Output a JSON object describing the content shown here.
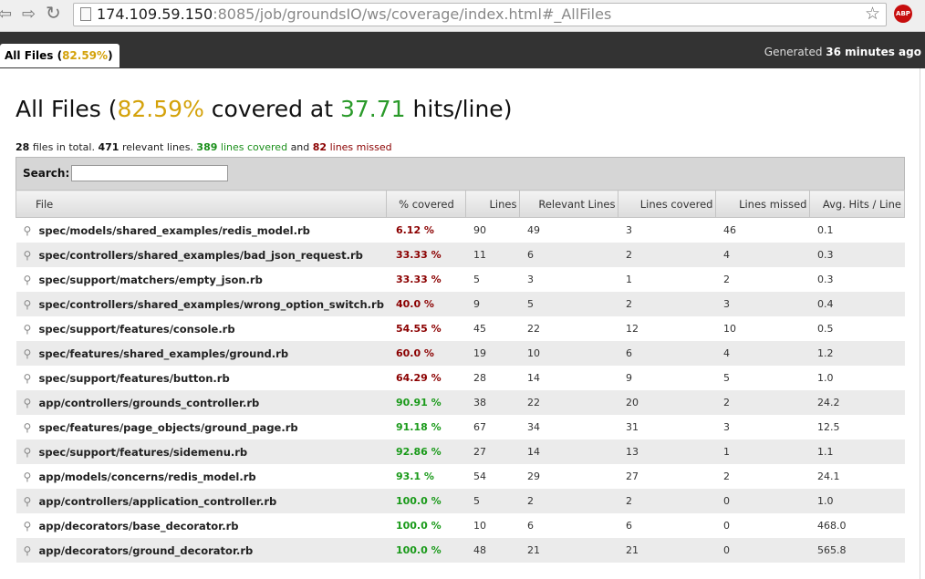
{
  "browser": {
    "url_host": "174.109.59.150",
    "url_path": ":8085/job/groundsIO/ws/coverage/index.html#_AllFiles",
    "adblock_label": "ABP"
  },
  "header": {
    "tab_label": "All Files",
    "tab_percent": "82.59%",
    "generated_prefix": "Generated",
    "generated_time": "36 minutes ago"
  },
  "summary": {
    "title_prefix": "All Files (",
    "coverage": "82.59%",
    "middle": "covered at",
    "hits": "37.71",
    "suffix": "hits/line)",
    "files_count": "28",
    "files_text": "files in total.",
    "relevant_count": "471",
    "relevant_text": "relevant lines.",
    "covered_count": "389",
    "covered_text": "lines covered",
    "and_text": "and",
    "missed_count": "82",
    "missed_text": "lines missed"
  },
  "search": {
    "label": "Search:",
    "value": ""
  },
  "table": {
    "columns": [
      "File",
      "% covered",
      "Lines",
      "Relevant Lines",
      "Lines covered",
      "Lines missed",
      "Avg. Hits / Line"
    ],
    "rows": [
      {
        "file": "spec/models/shared_examples/redis_model.rb",
        "pct": "6.12 %",
        "status": "red",
        "lines": "90",
        "relevant": "49",
        "covered": "3",
        "missed": "46",
        "avg": "0.1"
      },
      {
        "file": "spec/controllers/shared_examples/bad_json_request.rb",
        "pct": "33.33 %",
        "status": "red",
        "lines": "11",
        "relevant": "6",
        "covered": "2",
        "missed": "4",
        "avg": "0.3"
      },
      {
        "file": "spec/support/matchers/empty_json.rb",
        "pct": "33.33 %",
        "status": "red",
        "lines": "5",
        "relevant": "3",
        "covered": "1",
        "missed": "2",
        "avg": "0.3"
      },
      {
        "file": "spec/controllers/shared_examples/wrong_option_switch.rb",
        "pct": "40.0 %",
        "status": "red",
        "lines": "9",
        "relevant": "5",
        "covered": "2",
        "missed": "3",
        "avg": "0.4"
      },
      {
        "file": "spec/support/features/console.rb",
        "pct": "54.55 %",
        "status": "red",
        "lines": "45",
        "relevant": "22",
        "covered": "12",
        "missed": "10",
        "avg": "0.5"
      },
      {
        "file": "spec/features/shared_examples/ground.rb",
        "pct": "60.0 %",
        "status": "red",
        "lines": "19",
        "relevant": "10",
        "covered": "6",
        "missed": "4",
        "avg": "1.2"
      },
      {
        "file": "spec/support/features/button.rb",
        "pct": "64.29 %",
        "status": "red",
        "lines": "28",
        "relevant": "14",
        "covered": "9",
        "missed": "5",
        "avg": "1.0"
      },
      {
        "file": "app/controllers/grounds_controller.rb",
        "pct": "90.91 %",
        "status": "green",
        "lines": "38",
        "relevant": "22",
        "covered": "20",
        "missed": "2",
        "avg": "24.2"
      },
      {
        "file": "spec/features/page_objects/ground_page.rb",
        "pct": "91.18 %",
        "status": "green",
        "lines": "67",
        "relevant": "34",
        "covered": "31",
        "missed": "3",
        "avg": "12.5"
      },
      {
        "file": "spec/support/features/sidemenu.rb",
        "pct": "92.86 %",
        "status": "green",
        "lines": "27",
        "relevant": "14",
        "covered": "13",
        "missed": "1",
        "avg": "1.1"
      },
      {
        "file": "app/models/concerns/redis_model.rb",
        "pct": "93.1 %",
        "status": "green",
        "lines": "54",
        "relevant": "29",
        "covered": "27",
        "missed": "2",
        "avg": "24.1"
      },
      {
        "file": "app/controllers/application_controller.rb",
        "pct": "100.0 %",
        "status": "green",
        "lines": "5",
        "relevant": "2",
        "covered": "2",
        "missed": "0",
        "avg": "1.0"
      },
      {
        "file": "app/decorators/base_decorator.rb",
        "pct": "100.0 %",
        "status": "green",
        "lines": "10",
        "relevant": "6",
        "covered": "6",
        "missed": "0",
        "avg": "468.0"
      },
      {
        "file": "app/decorators/ground_decorator.rb",
        "pct": "100.0 %",
        "status": "green",
        "lines": "48",
        "relevant": "21",
        "covered": "21",
        "missed": "0",
        "avg": "565.8"
      }
    ]
  },
  "colors": {
    "coverage_yellow": "#d4a20b",
    "covered_green": "#1a9a1a",
    "missed_red": "#8b0000",
    "header_band": "#333333"
  }
}
